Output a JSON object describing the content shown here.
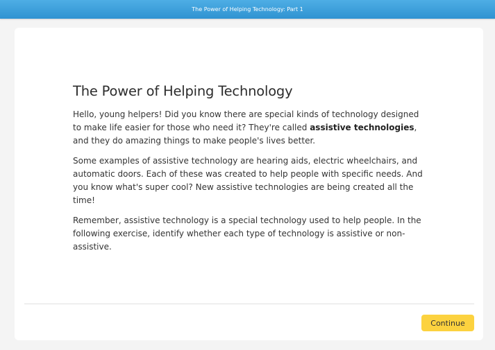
{
  "header": {
    "title": "The Power of Helping Technology: Part 1"
  },
  "lesson": {
    "heading": "The Power of Helping Technology",
    "paragraph1": {
      "before": "Hello, young helpers! Did you know there are special kinds of technology designed to make life easier for those who need it? They're called ",
      "bold": "assistive technologies",
      "after": ", and they do amazing things to make people's lives better."
    },
    "paragraph2": "Some examples of assistive technology are hearing aids, electric wheelchairs, and automatic doors. Each of these was created to help people with specific needs. And you know what's super cool? New assistive technologies are being created all the time!",
    "paragraph3": "Remember, assistive technology is a special technology used to help people. In the following exercise, identify whether each type of technology is assistive or non-assistive."
  },
  "footer": {
    "continue_label": "Continue"
  },
  "colors": {
    "header_blue": "#3aa0dc",
    "button_yellow": "#fcd23f",
    "background": "#f4f4f4"
  }
}
